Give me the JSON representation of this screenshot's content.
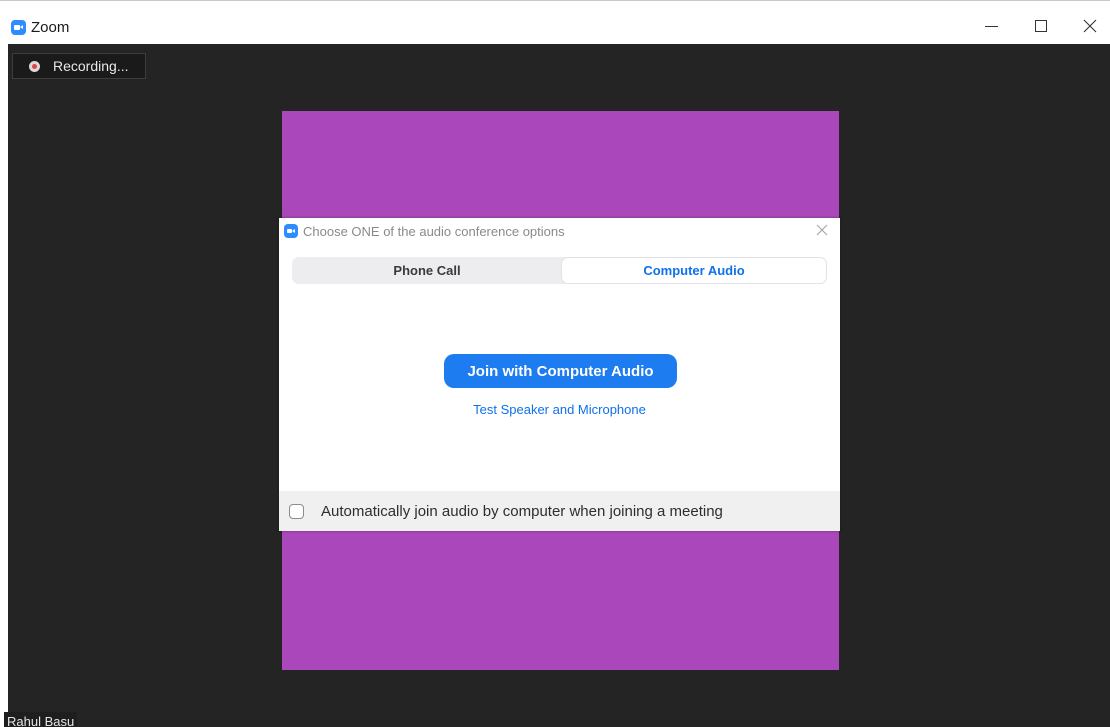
{
  "window": {
    "title": "Zoom",
    "icon": "zoom-app-icon"
  },
  "meeting": {
    "recording_label": "Recording...",
    "participant_name": "Rahul Basu",
    "video_tile_color": "#aa48bb"
  },
  "dialog": {
    "title": "Choose ONE of the audio conference options",
    "tabs": [
      {
        "label": "Phone Call",
        "selected": false
      },
      {
        "label": "Computer Audio",
        "selected": true
      }
    ],
    "join_button_label": "Join with Computer Audio",
    "test_link_label": "Test Speaker and Microphone",
    "auto_join_label": "Automatically join audio by computer when joining a meeting",
    "auto_join_checked": false
  },
  "colors": {
    "accent": "#0e71eb",
    "meeting_background": "#242424"
  }
}
